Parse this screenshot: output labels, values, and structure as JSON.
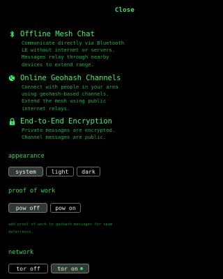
{
  "header": {
    "close_label": "Close"
  },
  "features": [
    {
      "icon": "bluetooth-icon",
      "title": "Offline Mesh Chat",
      "lines": [
        "Communicate directly via Bluetooth",
        "LE without internet or servers.",
        "Messages relay through nearby",
        "devices to extend range."
      ]
    },
    {
      "icon": "globe-icon",
      "title": "Online Geohash Channels",
      "lines": [
        "Connect with people in your area",
        "using geohash-based channels.",
        "Extend the mesh using public",
        "internet relays."
      ]
    },
    {
      "icon": "lock-icon",
      "title": "End-to-End Encryption",
      "lines": [
        "Private messages are encrypted.",
        "Channel messages are public."
      ]
    }
  ],
  "appearance": {
    "label": "appearance",
    "options": [
      "system",
      "light",
      "dark"
    ],
    "selected": "system"
  },
  "proof_of_work": {
    "label": "proof of work",
    "options": [
      "pow off",
      "pow on"
    ],
    "selected": "pow off",
    "hint_lines": [
      "add proof of work to geohash messages for spam",
      "deterrence."
    ]
  },
  "network": {
    "label": "network",
    "options": [
      "tor off",
      "tor on"
    ],
    "selected": "tor on",
    "status_indicator": "connected-dot"
  },
  "colors": {
    "accent": "#2ee05a",
    "background": "#000000",
    "button_border": "#6a6a6a",
    "button_selected_bg": "#2f3a33"
  }
}
